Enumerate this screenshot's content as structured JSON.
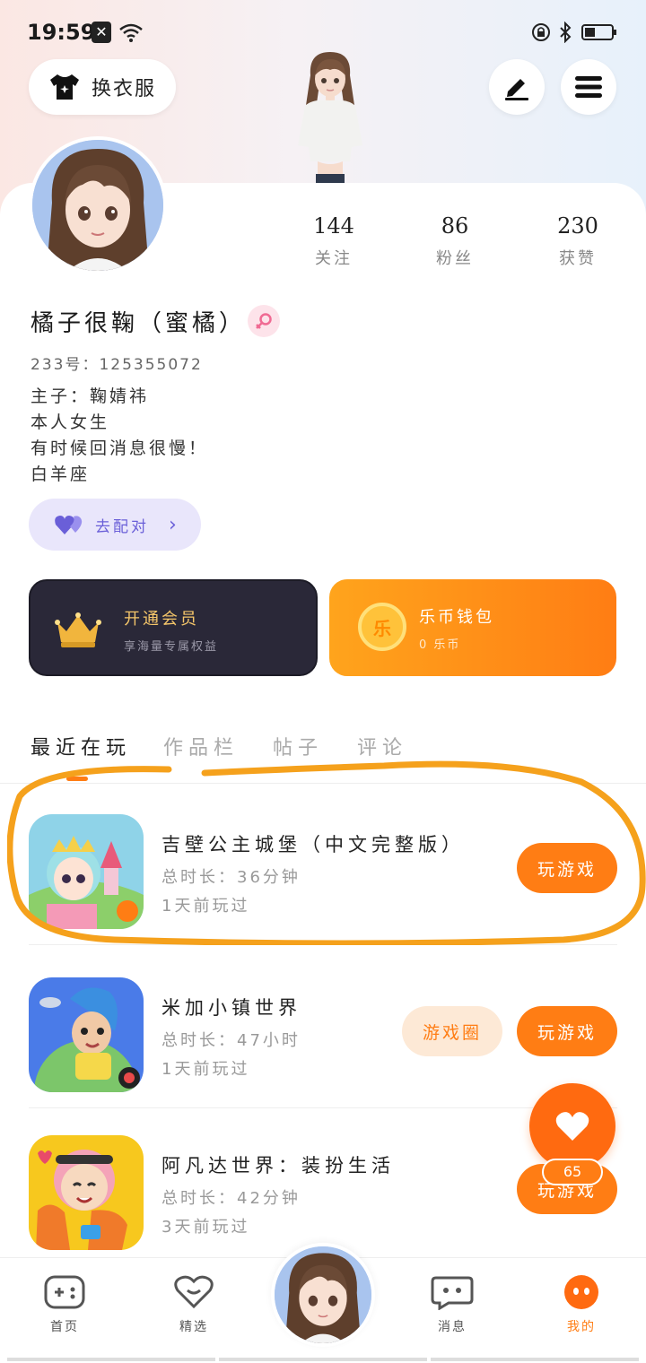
{
  "status_bar": {
    "time": "19:59",
    "notification_icon": "x-box-icon",
    "wifi_icon": "wifi-icon",
    "lock_icon": "rotation-lock-icon",
    "bluetooth_icon": "bluetooth-icon",
    "battery_icon": "battery-icon"
  },
  "header": {
    "outfit_label": "换衣服",
    "edit_icon": "pen-icon",
    "menu_icon": "hamburger-icon"
  },
  "profile": {
    "stats": [
      {
        "value": "144",
        "label": "关注"
      },
      {
        "value": "86",
        "label": "粉丝"
      },
      {
        "value": "230",
        "label": "获赞"
      }
    ],
    "nickname": "橘子很鞠（蜜橘）",
    "gender_icon": "female-icon",
    "uid": "233号：125355072",
    "bio": [
      "主子：鞠婧祎",
      "本人女生",
      "有时候回消息很慢！",
      "白羊座"
    ],
    "match_label": "去配对"
  },
  "vip": {
    "title": "开通会员",
    "subtitle": "享海量专属权益"
  },
  "wallet": {
    "title": "乐币钱包",
    "subtitle": "0 乐币",
    "coin_glyph": "乐"
  },
  "tabs": [
    "最近在玩",
    "作品栏",
    "帖子",
    "评论"
  ],
  "games": [
    {
      "title": "吉壁公主城堡（中文完整版）",
      "duration": "总时长：36分钟",
      "last_played": "1天前玩过",
      "play_label": "玩游戏"
    },
    {
      "title": "米加小镇世界",
      "duration": "总时长：47小时",
      "last_played": "1天前玩过",
      "circle_label": "游戏圈",
      "play_label": "玩游戏"
    },
    {
      "title": "阿凡达世界：装扮生活",
      "duration": "总时长：42分钟",
      "last_played": "3天前玩过",
      "play_label": "玩游戏"
    }
  ],
  "fab": {
    "count": "65",
    "icon": "heart-icon"
  },
  "bottom_nav": [
    {
      "label": "首页",
      "icon": "gamepad-icon"
    },
    {
      "label": "精选",
      "icon": "heart-outline-icon"
    },
    {
      "label": "消息",
      "icon": "chat-bubble-icon"
    },
    {
      "label": "我的",
      "icon": "face-icon"
    }
  ],
  "colors": {
    "accent": "#ff7d14",
    "vip_gold": "#f5c66a",
    "match_purple": "#6a5fd8"
  }
}
